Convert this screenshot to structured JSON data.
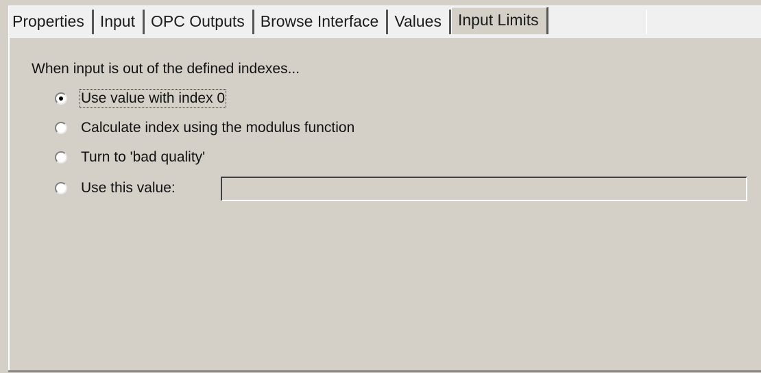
{
  "tabs": [
    {
      "label": "Properties",
      "active": false
    },
    {
      "label": "Input",
      "active": false
    },
    {
      "label": "OPC Outputs",
      "active": false
    },
    {
      "label": "Browse Interface",
      "active": false
    },
    {
      "label": "Values",
      "active": false
    },
    {
      "label": "Input Limits",
      "active": true
    }
  ],
  "input_limits": {
    "heading": "When input is out of the defined indexes...",
    "options": [
      {
        "label": "Use value with index 0",
        "checked": true
      },
      {
        "label": "Calculate index using the modulus function",
        "checked": false
      },
      {
        "label": "Turn to 'bad quality'",
        "checked": false
      },
      {
        "label": "Use this value:",
        "checked": false
      }
    ],
    "custom_value": {
      "value": "",
      "enabled": false
    }
  }
}
